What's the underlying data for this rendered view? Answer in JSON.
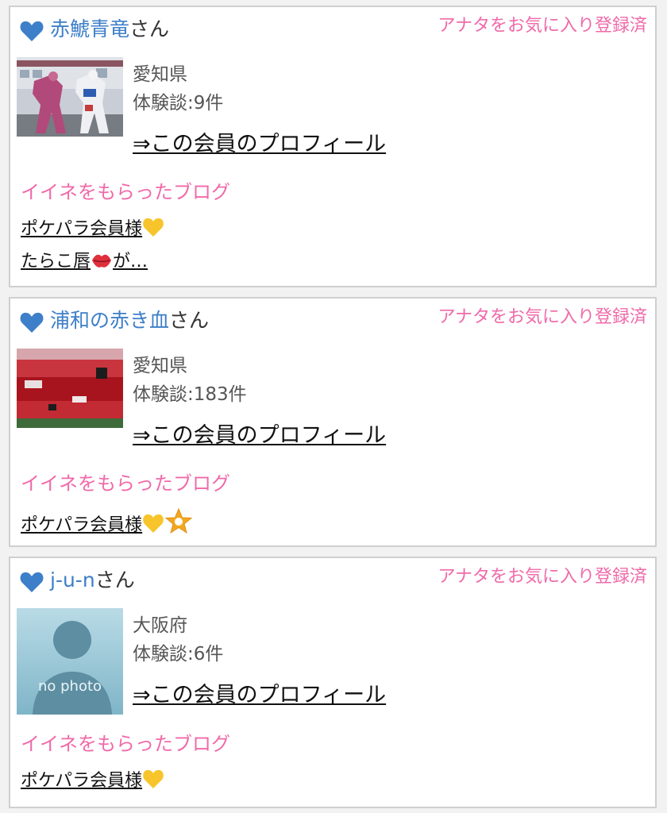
{
  "members": [
    {
      "name": "赤鯱青竜",
      "honorific": "さん",
      "favorite_status": "アナタをお気に入り登録済",
      "prefecture": "愛知県",
      "experience_count": "体験談:9件",
      "profile_link": "⇒この会員のプロフィール",
      "liked_blogs_heading": "イイネをもらったブログ",
      "blogs": [
        "ポケパラ会員様",
        "たらこ唇",
        "が…"
      ],
      "thumbnail": "robot-statues-photo"
    },
    {
      "name": "浦和の赤き血",
      "honorific": "さん",
      "favorite_status": "アナタをお気に入り登録済",
      "prefecture": "愛知県",
      "experience_count": "体験談:183件",
      "profile_link": "⇒この会員のプロフィール",
      "liked_blogs_heading": "イイネをもらったブログ",
      "blogs": [
        "ポケパラ会員様"
      ],
      "thumbnail": "stadium-crowd-photo"
    },
    {
      "name": "j-u-n",
      "honorific": "さん",
      "favorite_status": "アナタをお気に入り登録済",
      "prefecture": "大阪府",
      "experience_count": "体験談:6件",
      "profile_link": "⇒この会員のプロフィール",
      "liked_blogs_heading": "イイネをもらったブログ",
      "blogs": [
        "ポケパラ会員様"
      ],
      "thumbnail": "no-photo-placeholder",
      "thumbnail_text": "no photo"
    }
  ],
  "colors": {
    "name": "#3d7fc9",
    "accent_pink": "#f06aa9",
    "heart": "#3d7fc9",
    "border": "#cfcfcf"
  }
}
